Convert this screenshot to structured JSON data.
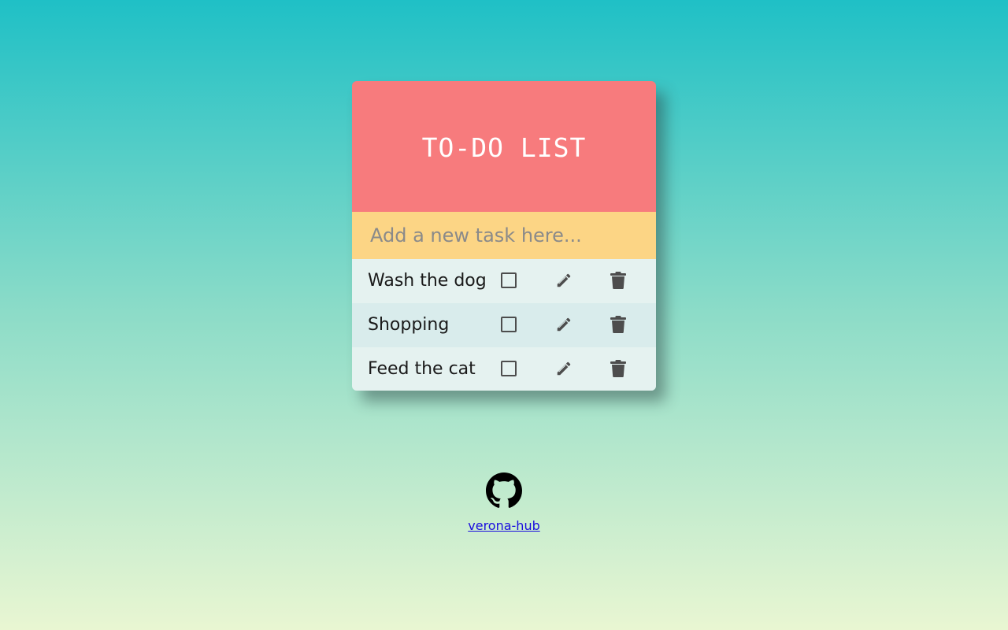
{
  "header": {
    "title": "TO-DO LIST"
  },
  "new_task": {
    "placeholder": "Add a new task here...",
    "value": ""
  },
  "tasks": [
    {
      "text": "Wash the dog",
      "done": false
    },
    {
      "text": "Shopping",
      "done": false
    },
    {
      "text": "Feed the cat",
      "done": false
    }
  ],
  "icons": {
    "checkbox": "checkbox-icon",
    "edit": "pencil-icon",
    "delete": "trash-icon",
    "footer": "github-icon"
  },
  "footer": {
    "link_text": "verona-hub"
  },
  "colors": {
    "header": "#f77b7d",
    "input": "#fcd585",
    "row": "#e5f2f0",
    "row_alt": "#d9ecec",
    "link": "#1a0dde"
  }
}
